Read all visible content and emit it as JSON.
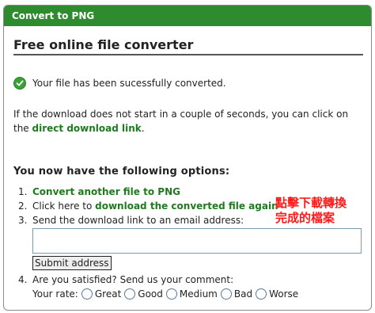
{
  "header": {
    "title": "Convert to PNG"
  },
  "main": {
    "title": "Free online file converter",
    "success_text": "Your file has been sucessfully converted.",
    "download_para": {
      "text_before": "If the download does not start in a couple of seconds, you can click on the",
      "link": "direct download link",
      "text_after": "."
    },
    "options_heading": "You now have the following options:",
    "option1": {
      "num": "1.",
      "link": "Convert another file to PNG"
    },
    "option2": {
      "num": "2.",
      "text": "Click here to",
      "link": "download the converted file again"
    },
    "option3": {
      "num": "3.",
      "text": "Send the download link to an email address:"
    },
    "email_value": "",
    "submit_label": "Submit address",
    "option4": {
      "num": "4.",
      "text": "Are you satisfied? Send us your comment:"
    },
    "rate_label": "Your rate:",
    "rates": [
      "Great",
      "Good",
      "Medium",
      "Bad",
      "Worse"
    ]
  },
  "annotation": {
    "line1": "點擊下載轉換",
    "line2": "完成的檔案"
  },
  "colors": {
    "header_bg": "#2e8b2e",
    "link": "#1f7a1f",
    "annotation": "#ff1a1a"
  },
  "icons": {
    "success": "check-circle-icon"
  }
}
